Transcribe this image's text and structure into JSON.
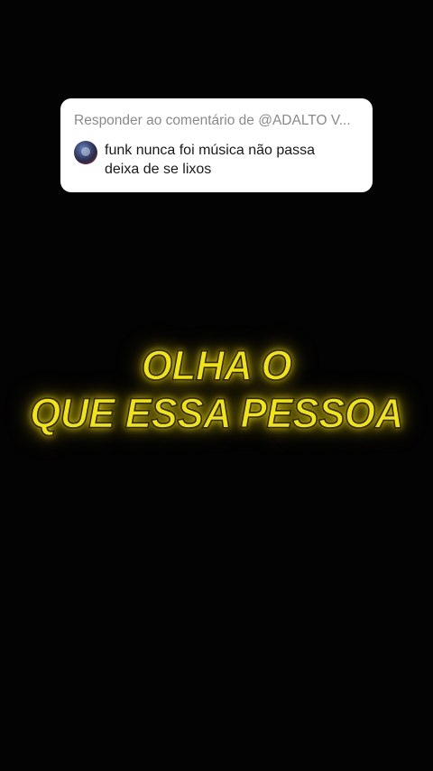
{
  "reply": {
    "header": "Responder ao comentário de @ADALTO V...",
    "comment_text": "funk nunca foi música não passa deixa de se lixos"
  },
  "caption": {
    "line1": "OLHA O",
    "line2": "QUE ESSA PESSOA"
  },
  "colors": {
    "background": "#030303",
    "card": "#ffffff",
    "caption": "#f1e40f"
  }
}
